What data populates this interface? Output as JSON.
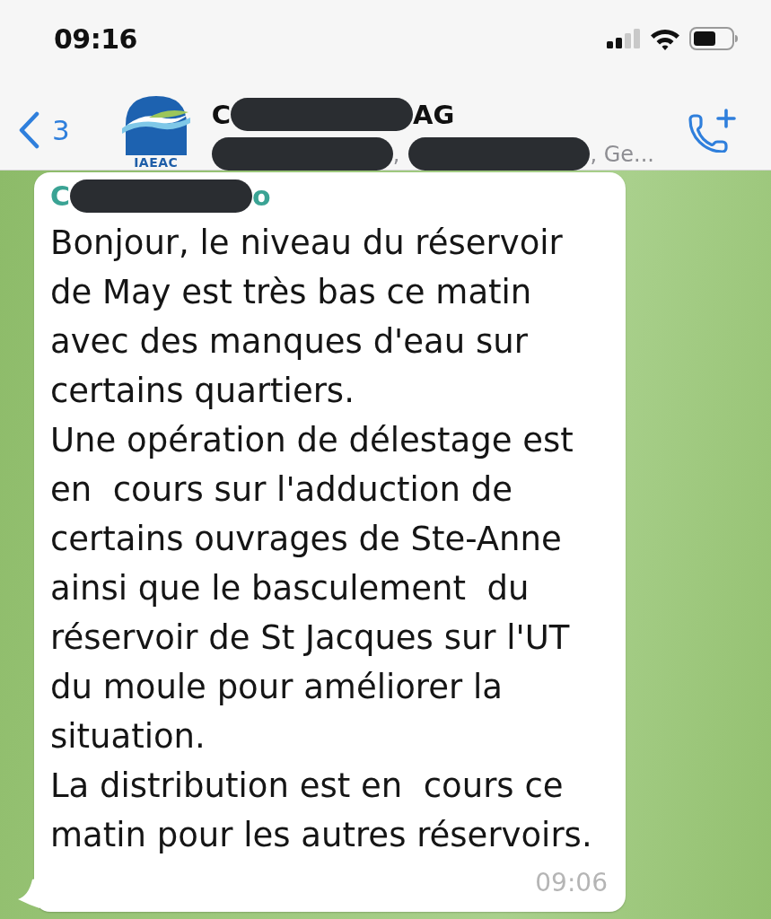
{
  "status_bar": {
    "time": "09:16"
  },
  "header": {
    "back_count": "3",
    "avatar": {
      "caption": "IAEAC"
    },
    "title": [
      {
        "kind": "text",
        "text": "C"
      },
      {
        "kind": "redacted"
      },
      {
        "kind": "text",
        "text": "AG"
      }
    ],
    "subtitle": [
      {
        "kind": "redacted"
      },
      {
        "kind": "text",
        "text": ","
      },
      {
        "kind": "redacted"
      },
      {
        "kind": "text",
        "text": ", Ge..."
      }
    ]
  },
  "message": {
    "sender": [
      {
        "kind": "text",
        "text": "C"
      },
      {
        "kind": "redacted"
      },
      {
        "kind": "text",
        "text": "o"
      }
    ],
    "paragraphs": [
      "Bonjour, le niveau du réservoir de May est très bas ce matin avec des manques d'eau sur certains quartiers.",
      "Une opération de délestage est en  cours sur l'adduction de certains ouvrages de Ste-Anne ainsi que le basculement  du réservoir de St Jacques sur l'UT du moule pour améliorer la situation.",
      "La distribution est en  cours ce matin pour les autres réservoirs."
    ],
    "time": "09:06"
  }
}
